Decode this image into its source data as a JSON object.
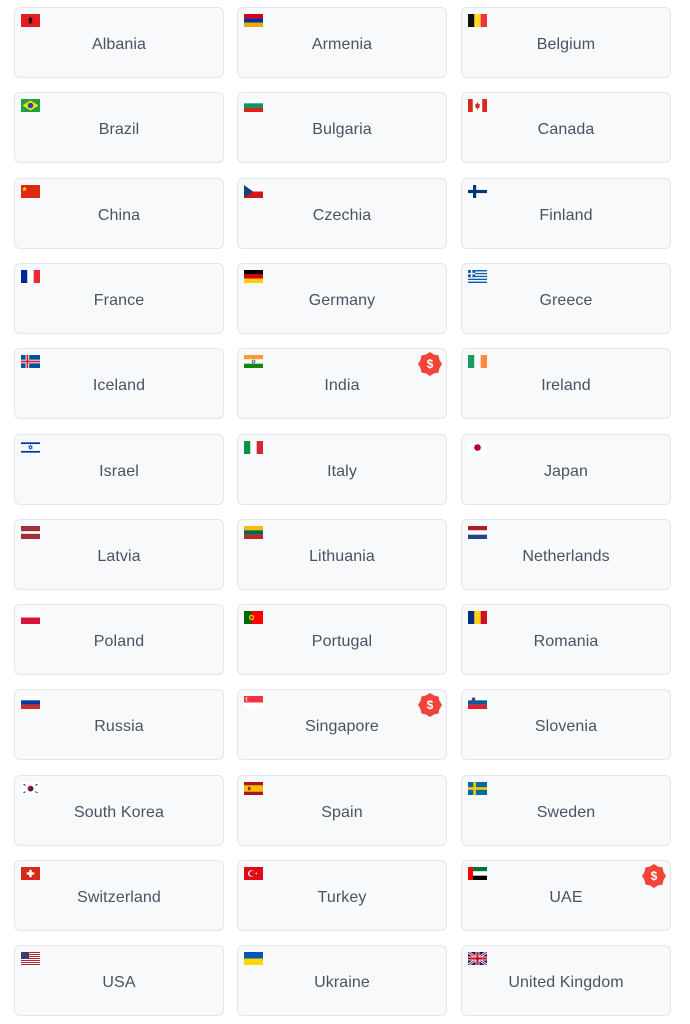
{
  "countries": [
    {
      "name": "Albania",
      "flag": "albania-flag-icon",
      "premium": false
    },
    {
      "name": "Armenia",
      "flag": "armenia-flag-icon",
      "premium": false
    },
    {
      "name": "Belgium",
      "flag": "belgium-flag-icon",
      "premium": false
    },
    {
      "name": "Brazil",
      "flag": "brazil-flag-icon",
      "premium": false
    },
    {
      "name": "Bulgaria",
      "flag": "bulgaria-flag-icon",
      "premium": false
    },
    {
      "name": "Canada",
      "flag": "canada-flag-icon",
      "premium": false
    },
    {
      "name": "China",
      "flag": "china-flag-icon",
      "premium": false
    },
    {
      "name": "Czechia",
      "flag": "czechia-flag-icon",
      "premium": false
    },
    {
      "name": "Finland",
      "flag": "finland-flag-icon",
      "premium": false
    },
    {
      "name": "France",
      "flag": "france-flag-icon",
      "premium": false
    },
    {
      "name": "Germany",
      "flag": "germany-flag-icon",
      "premium": false
    },
    {
      "name": "Greece",
      "flag": "greece-flag-icon",
      "premium": false
    },
    {
      "name": "Iceland",
      "flag": "iceland-flag-icon",
      "premium": false
    },
    {
      "name": "India",
      "flag": "india-flag-icon",
      "premium": true
    },
    {
      "name": "Ireland",
      "flag": "ireland-flag-icon",
      "premium": false
    },
    {
      "name": "Israel",
      "flag": "israel-flag-icon",
      "premium": false
    },
    {
      "name": "Italy",
      "flag": "italy-flag-icon",
      "premium": false
    },
    {
      "name": "Japan",
      "flag": "japan-flag-icon",
      "premium": false
    },
    {
      "name": "Latvia",
      "flag": "latvia-flag-icon",
      "premium": false
    },
    {
      "name": "Lithuania",
      "flag": "lithuania-flag-icon",
      "premium": false
    },
    {
      "name": "Netherlands",
      "flag": "netherlands-flag-icon",
      "premium": false
    },
    {
      "name": "Poland",
      "flag": "poland-flag-icon",
      "premium": false
    },
    {
      "name": "Portugal",
      "flag": "portugal-flag-icon",
      "premium": false
    },
    {
      "name": "Romania",
      "flag": "romania-flag-icon",
      "premium": false
    },
    {
      "name": "Russia",
      "flag": "russia-flag-icon",
      "premium": false
    },
    {
      "name": "Singapore",
      "flag": "singapore-flag-icon",
      "premium": true
    },
    {
      "name": "Slovenia",
      "flag": "slovenia-flag-icon",
      "premium": false
    },
    {
      "name": "South Korea",
      "flag": "south-korea-flag-icon",
      "premium": false
    },
    {
      "name": "Spain",
      "flag": "spain-flag-icon",
      "premium": false
    },
    {
      "name": "Sweden",
      "flag": "sweden-flag-icon",
      "premium": false
    },
    {
      "name": "Switzerland",
      "flag": "switzerland-flag-icon",
      "premium": false
    },
    {
      "name": "Turkey",
      "flag": "turkey-flag-icon",
      "premium": false
    },
    {
      "name": "UAE",
      "flag": "uae-flag-icon",
      "premium": true
    },
    {
      "name": "USA",
      "flag": "usa-flag-icon",
      "premium": false
    },
    {
      "name": "Ukraine",
      "flag": "ukraine-flag-icon",
      "premium": false
    },
    {
      "name": "United Kingdom",
      "flag": "united-kingdom-flag-icon",
      "premium": false
    }
  ],
  "premium_badge": {
    "symbol": "$",
    "icon": "dollar-badge-icon",
    "color": "#f04438"
  }
}
